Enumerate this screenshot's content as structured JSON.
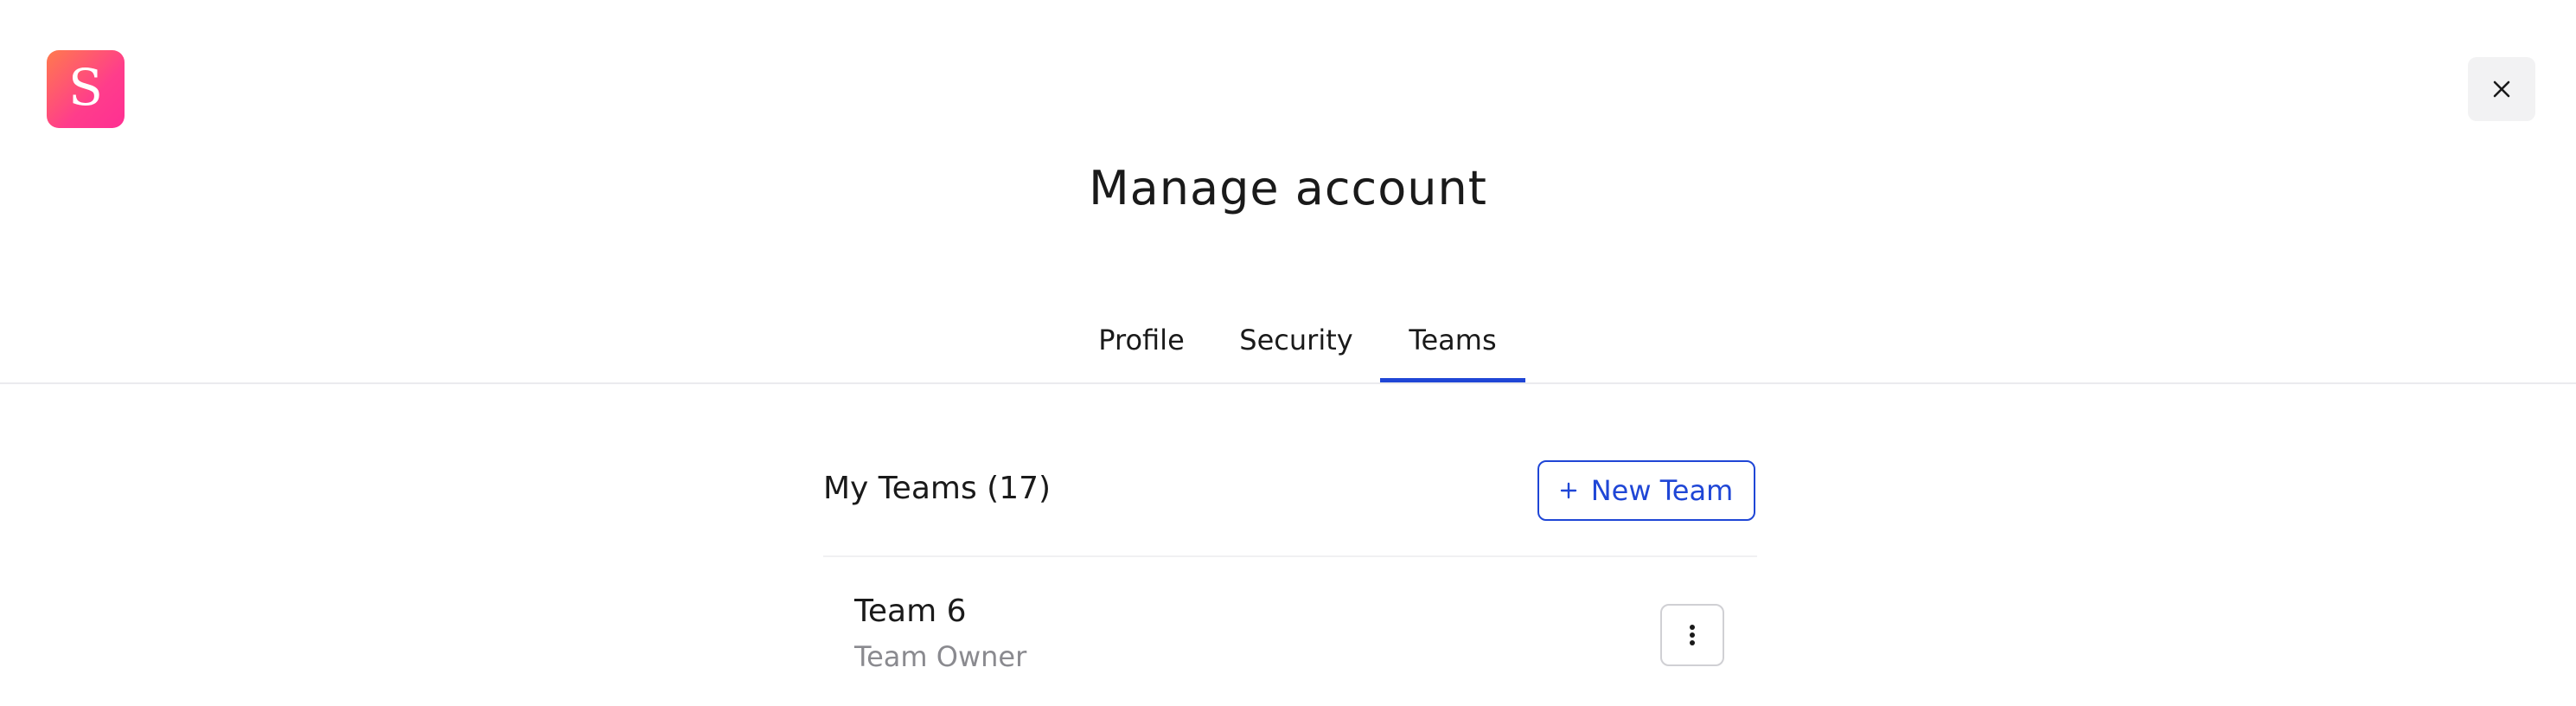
{
  "app": {
    "logo_letter": "S",
    "brand_gradient": [
      "#ff7a4d",
      "#ff2f93"
    ],
    "accent_color": "#1f46d6"
  },
  "header": {
    "title": "Manage account",
    "close_icon": "close-icon"
  },
  "tabs": [
    {
      "label": "Profile",
      "active": false
    },
    {
      "label": "Security",
      "active": false
    },
    {
      "label": "Teams",
      "active": true
    }
  ],
  "teams_section": {
    "title": "My Teams (17)",
    "new_team_label": "New Team",
    "new_team_icon": "plus-icon"
  },
  "teams": [
    {
      "name": "Team 6",
      "role": "Team Owner",
      "menu_icon": "more-vertical-icon"
    }
  ]
}
